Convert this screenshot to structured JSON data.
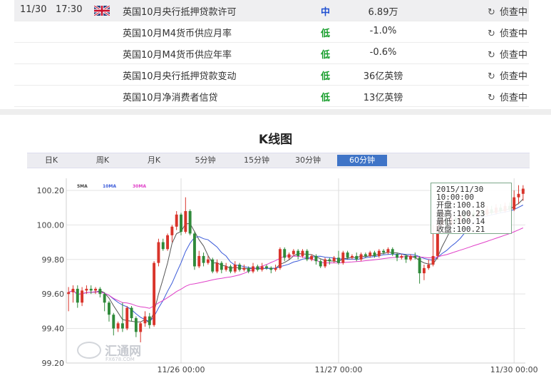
{
  "calendar": {
    "rows": [
      {
        "date": "11/30",
        "time": "17:30",
        "title": "英国10月央行抵押贷款许可",
        "importance": "中",
        "value": "6.89万",
        "status": "侦查中"
      },
      {
        "title": "英国10月M4货币供应月率",
        "importance": "低",
        "value": "-1.0%",
        "status": "侦查中"
      },
      {
        "title": "英国10月M4货币供应年率",
        "importance": "低",
        "value": "-0.6%",
        "status": "侦查中"
      },
      {
        "title": "英国10月央行抵押贷款变动",
        "importance": "低",
        "value": "36亿英镑",
        "status": "侦查中"
      },
      {
        "title": "英国10月净消费者信贷",
        "importance": "低",
        "value": "13亿英镑",
        "status": "侦查中"
      }
    ]
  },
  "chart_title": "K线图",
  "tabs": [
    "日K",
    "周K",
    "月K",
    "5分钟",
    "15分钟",
    "30分钟",
    "60分钟"
  ],
  "active_tab": "60分钟",
  "legend": [
    "5MA",
    "10MA",
    "30MA"
  ],
  "tooltip": {
    "date": "2015/11/30",
    "time": "10:00:00",
    "open_label": "开盘",
    "open": "100.18",
    "high_label": "最高",
    "high": "100.23",
    "low_label": "最低",
    "low": "100.14",
    "close_label": "收盘",
    "close": "100.21"
  },
  "watermark": {
    "name": "汇通网",
    "domain": "FX678.COM"
  },
  "colors": {
    "up": "#d9342b",
    "down": "#2f8a3a",
    "ma5": "#555555",
    "ma10": "#3b5bd9",
    "ma30": "#e040c8",
    "active_tab": "#3f74c7",
    "importance_mid": "#1f4fd1",
    "importance_low": "#169d2b"
  },
  "chart_data": {
    "type": "candlestick",
    "y_ticks": [
      "100.20",
      "100.00",
      "99.80",
      "99.60",
      "99.40",
      "99.20"
    ],
    "ylim": [
      99.2,
      100.27
    ],
    "x_ticks": [
      "11/26 00:00",
      "11/27 00:00",
      "11/30 00:00"
    ],
    "x_tick_bars": [
      25,
      60,
      99
    ],
    "candles": [
      [
        99.6,
        99.61,
        99.5,
        99.64
      ],
      [
        99.61,
        99.63,
        99.55,
        99.65
      ],
      [
        99.63,
        99.55,
        99.52,
        99.65
      ],
      [
        99.55,
        99.62,
        99.53,
        99.64
      ],
      [
        99.62,
        99.63,
        99.6,
        99.65
      ],
      [
        99.63,
        99.62,
        99.6,
        99.65
      ],
      [
        99.62,
        99.63,
        99.6,
        99.64
      ],
      [
        99.63,
        99.6,
        99.58,
        99.64
      ],
      [
        99.6,
        99.55,
        99.5,
        99.61
      ],
      [
        99.55,
        99.48,
        99.44,
        99.56
      ],
      [
        99.48,
        99.4,
        99.36,
        99.49
      ],
      [
        99.4,
        99.43,
        99.38,
        99.44
      ],
      [
        99.43,
        99.4,
        99.38,
        99.55
      ],
      [
        99.4,
        99.52,
        99.39,
        99.53
      ],
      [
        99.52,
        99.46,
        99.44,
        99.53
      ],
      [
        99.46,
        99.38,
        99.35,
        99.47
      ],
      [
        99.38,
        99.43,
        99.32,
        99.44
      ],
      [
        99.43,
        99.47,
        99.41,
        99.5
      ],
      [
        99.47,
        99.42,
        99.4,
        99.49
      ],
      [
        99.42,
        99.78,
        99.41,
        99.79
      ],
      [
        99.78,
        99.9,
        99.76,
        99.92
      ],
      [
        99.9,
        99.86,
        99.85,
        99.92
      ],
      [
        99.86,
        99.94,
        99.85,
        99.95
      ],
      [
        99.94,
        99.99,
        99.9,
        100.0
      ],
      [
        99.99,
        100.06,
        99.97,
        100.08
      ],
      [
        100.06,
        99.96,
        99.94,
        100.07
      ],
      [
        99.96,
        100.08,
        99.95,
        100.16
      ],
      [
        100.08,
        99.95,
        99.94,
        100.09
      ],
      [
        99.95,
        99.76,
        99.74,
        99.96
      ],
      [
        99.76,
        99.82,
        99.75,
        99.85
      ],
      [
        99.82,
        99.78,
        99.76,
        99.84
      ],
      [
        99.78,
        99.8,
        99.77,
        99.82
      ],
      [
        99.8,
        99.73,
        99.72,
        99.81
      ],
      [
        99.73,
        99.78,
        99.72,
        99.8
      ],
      [
        99.78,
        99.74,
        99.72,
        99.79
      ],
      [
        99.74,
        99.76,
        99.73,
        99.78
      ],
      [
        99.76,
        99.73,
        99.72,
        99.77
      ],
      [
        99.73,
        99.77,
        99.72,
        99.79
      ],
      [
        99.77,
        99.74,
        99.73,
        99.78
      ],
      [
        99.74,
        99.75,
        99.73,
        99.77
      ],
      [
        99.75,
        99.73,
        99.72,
        99.76
      ],
      [
        99.73,
        99.76,
        99.72,
        99.78
      ],
      [
        99.76,
        99.74,
        99.73,
        99.77
      ],
      [
        99.74,
        99.76,
        99.73,
        99.78
      ],
      [
        99.76,
        99.75,
        99.74,
        99.77
      ],
      [
        99.75,
        99.74,
        99.72,
        99.76
      ],
      [
        99.74,
        99.75,
        99.73,
        99.77
      ],
      [
        99.75,
        99.86,
        99.74,
        99.87
      ],
      [
        99.86,
        99.81,
        99.79,
        99.87
      ],
      [
        99.81,
        99.83,
        99.8,
        99.84
      ],
      [
        99.83,
        99.85,
        99.82,
        99.86
      ],
      [
        99.85,
        99.82,
        99.8,
        99.86
      ],
      [
        99.82,
        99.85,
        99.81,
        99.86
      ],
      [
        99.85,
        99.8,
        99.79,
        99.86
      ],
      [
        99.8,
        99.82,
        99.79,
        99.83
      ],
      [
        99.82,
        99.79,
        99.77,
        99.83
      ],
      [
        99.79,
        99.76,
        99.75,
        99.8
      ],
      [
        99.76,
        99.8,
        99.75,
        99.81
      ],
      [
        99.8,
        99.79,
        99.77,
        99.81
      ],
      [
        99.79,
        99.81,
        99.78,
        99.82
      ],
      [
        99.81,
        99.78,
        99.77,
        99.85
      ],
      [
        99.78,
        99.84,
        99.77,
        99.85
      ],
      [
        99.84,
        99.81,
        99.8,
        99.85
      ],
      [
        99.81,
        99.82,
        99.8,
        99.83
      ],
      [
        99.82,
        99.8,
        99.79,
        99.84
      ],
      [
        99.8,
        99.83,
        99.79,
        99.84
      ],
      [
        99.83,
        99.82,
        99.81,
        99.84
      ],
      [
        99.82,
        99.84,
        99.81,
        99.85
      ],
      [
        99.84,
        99.82,
        99.81,
        99.85
      ],
      [
        99.82,
        99.85,
        99.81,
        99.86
      ],
      [
        99.85,
        99.84,
        99.83,
        99.86
      ],
      [
        99.84,
        99.86,
        99.83,
        99.87
      ],
      [
        99.86,
        99.83,
        99.82,
        99.87
      ],
      [
        99.83,
        99.81,
        99.79,
        99.84
      ],
      [
        99.81,
        99.82,
        99.8,
        99.83
      ],
      [
        99.82,
        99.8,
        99.78,
        99.83
      ],
      [
        99.8,
        99.82,
        99.79,
        99.83
      ],
      [
        99.82,
        99.81,
        99.8,
        99.84
      ],
      [
        99.81,
        99.72,
        99.66,
        99.82
      ],
      [
        99.72,
        99.75,
        99.68,
        99.77
      ],
      [
        99.75,
        99.77,
        99.74,
        99.8
      ],
      [
        99.77,
        99.82,
        99.76,
        100.0
      ],
      [
        99.82,
        100.0,
        99.8,
        100.03
      ],
      [
        100.0,
        100.03,
        99.99,
        100.1
      ],
      [
        100.03,
        100.0,
        99.98,
        100.06
      ],
      [
        100.0,
        100.04,
        99.99,
        100.06
      ],
      [
        100.04,
        100.02,
        100.0,
        100.06
      ],
      [
        100.02,
        100.06,
        100.01,
        100.08
      ],
      [
        100.06,
        100.04,
        100.03,
        100.08
      ],
      [
        100.04,
        100.07,
        100.03,
        100.09
      ],
      [
        100.07,
        100.05,
        100.04,
        100.09
      ],
      [
        100.05,
        100.08,
        100.04,
        100.1
      ],
      [
        100.08,
        100.06,
        100.05,
        100.1
      ],
      [
        100.06,
        100.09,
        100.05,
        100.11
      ],
      [
        100.09,
        100.07,
        100.06,
        100.11
      ],
      [
        100.07,
        100.1,
        100.06,
        100.12
      ],
      [
        100.1,
        100.08,
        100.07,
        100.12
      ],
      [
        100.08,
        100.11,
        100.07,
        100.13
      ],
      [
        100.11,
        100.09,
        100.08,
        100.13
      ],
      [
        100.09,
        100.16,
        100.08,
        100.2
      ],
      [
        100.16,
        100.18,
        100.12,
        100.23
      ],
      [
        100.18,
        100.21,
        100.14,
        100.23
      ]
    ]
  }
}
